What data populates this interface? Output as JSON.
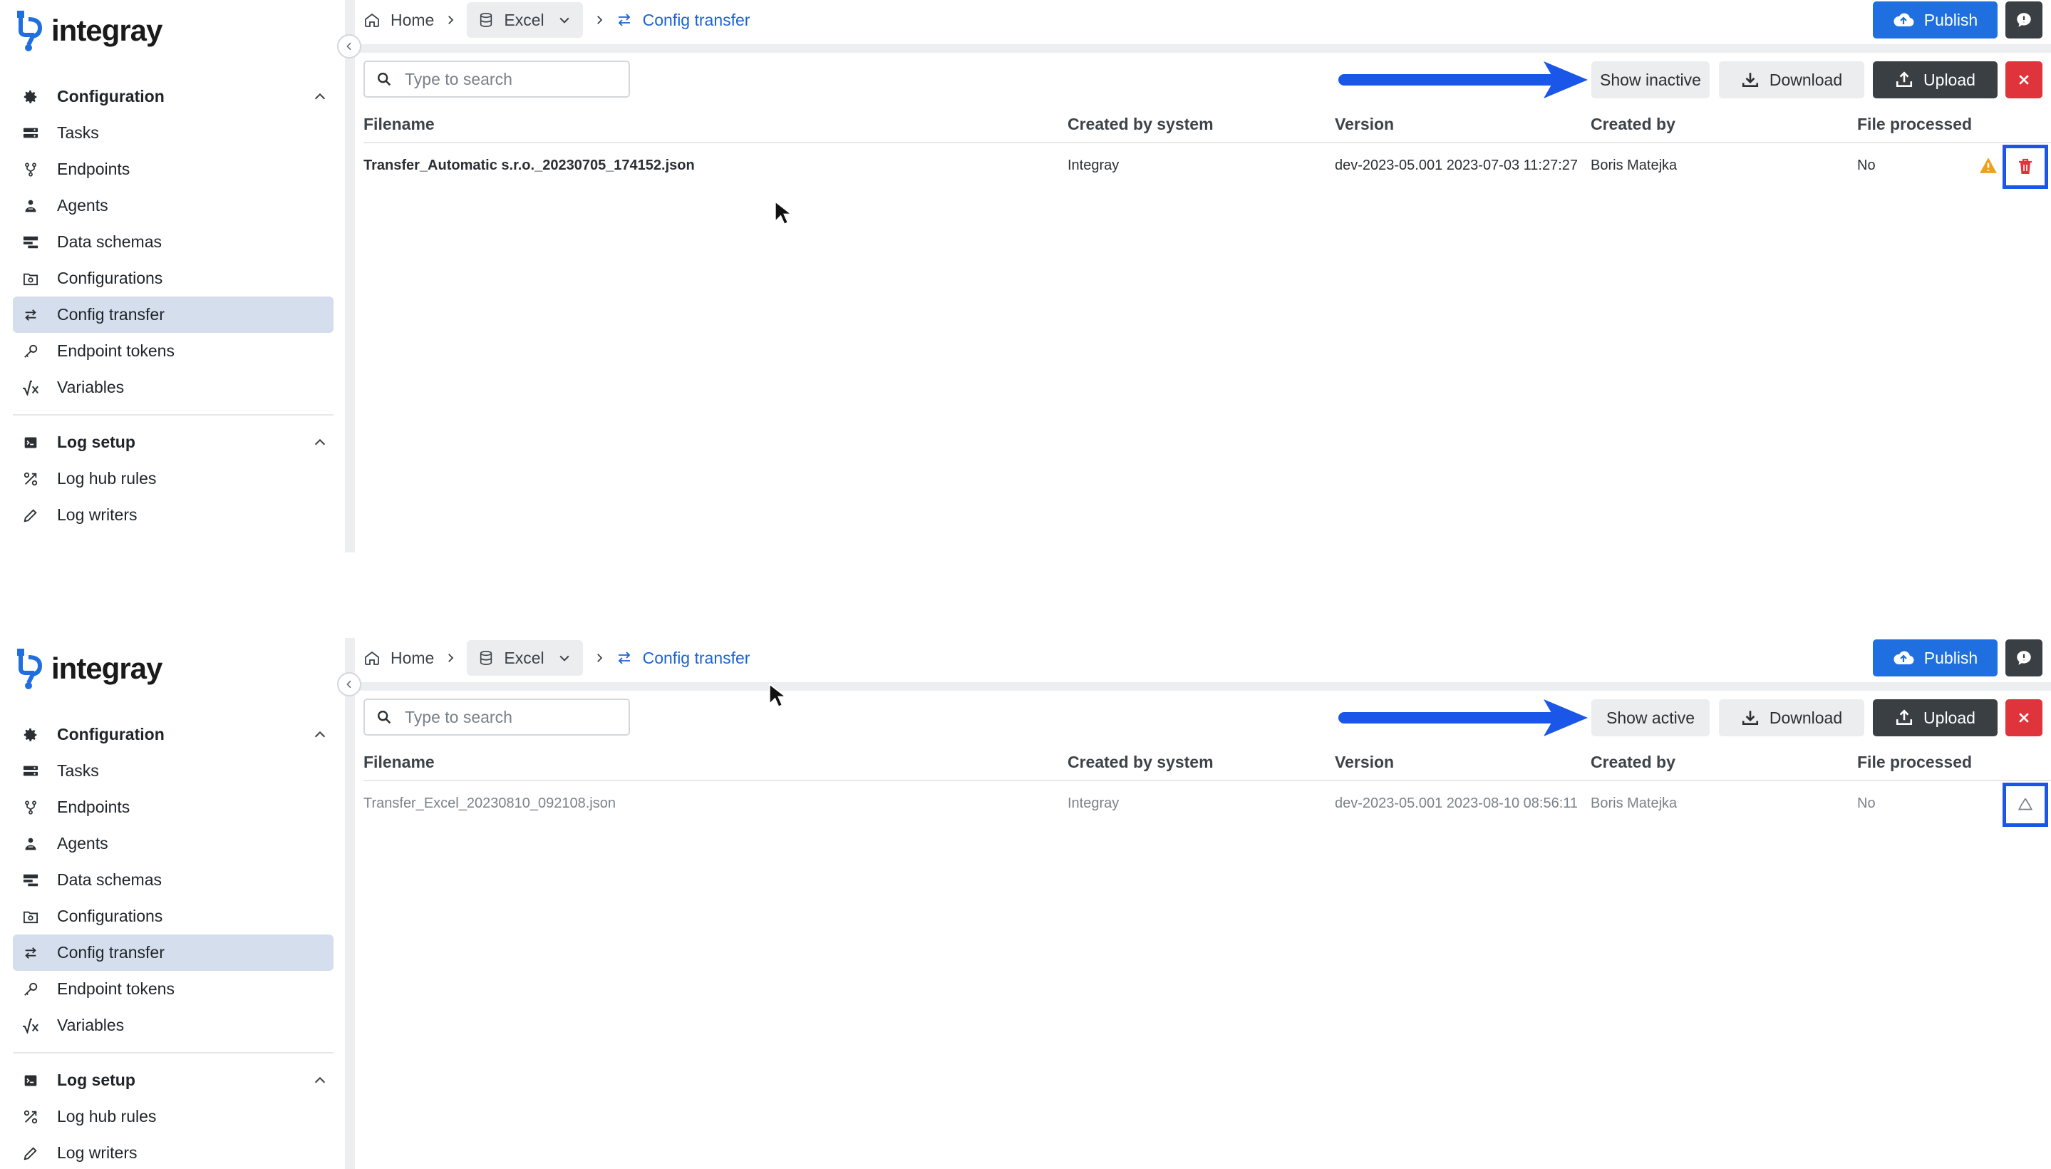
{
  "app": {
    "logo_text": "integray",
    "colors": {
      "accent": "#1f6fe0",
      "active_nav": "#d5deec",
      "danger": "#e0343d",
      "dark": "#3a3f44",
      "highlight": "#1a56e8",
      "warning": "#f0a020"
    }
  },
  "panels": [
    {
      "sidebar": {
        "config_group": "Configuration",
        "items": [
          {
            "label": "Tasks",
            "icon": "tasks-icon"
          },
          {
            "label": "Endpoints",
            "icon": "endpoints-icon"
          },
          {
            "label": "Agents",
            "icon": "agents-icon"
          },
          {
            "label": "Data schemas",
            "icon": "data-schemas-icon"
          },
          {
            "label": "Configurations",
            "icon": "configurations-icon"
          },
          {
            "label": "Config transfer",
            "icon": "transfer-icon",
            "active": true
          },
          {
            "label": "Endpoint tokens",
            "icon": "key-icon"
          },
          {
            "label": "Variables",
            "icon": "variables-icon"
          }
        ],
        "log_group": "Log setup",
        "log_items": [
          {
            "label": "Log hub rules",
            "icon": "log-hub-rules-icon"
          },
          {
            "label": "Log writers",
            "icon": "pen-icon"
          }
        ]
      },
      "breadcrumb": {
        "home": "Home",
        "project": "Excel",
        "current": "Config transfer"
      },
      "toolbar": {
        "publish": "Publish",
        "toggle": "Show inactive",
        "download": "Download",
        "upload": "Upload"
      },
      "search": {
        "placeholder": "Type to search"
      },
      "table": {
        "headers": [
          "Filename",
          "Created by system",
          "Version",
          "Created by",
          "File processed"
        ],
        "row": {
          "filename": "Transfer_Automatic s.r.o._20230705_174152.json",
          "system": "Integray",
          "version": "dev-2023-05.001 2023-07-03 11:27:27",
          "created_by": "Boris Matejka",
          "processed": "No",
          "action": "trash-icon",
          "warning": true
        }
      }
    },
    {
      "sidebar": {
        "config_group": "Configuration",
        "items": [
          {
            "label": "Tasks",
            "icon": "tasks-icon"
          },
          {
            "label": "Endpoints",
            "icon": "endpoints-icon"
          },
          {
            "label": "Agents",
            "icon": "agents-icon"
          },
          {
            "label": "Data schemas",
            "icon": "data-schemas-icon"
          },
          {
            "label": "Configurations",
            "icon": "configurations-icon"
          },
          {
            "label": "Config transfer",
            "icon": "transfer-icon",
            "active": true
          },
          {
            "label": "Endpoint tokens",
            "icon": "key-icon"
          },
          {
            "label": "Variables",
            "icon": "variables-icon"
          }
        ],
        "log_group": "Log setup",
        "log_items": [
          {
            "label": "Log hub rules",
            "icon": "log-hub-rules-icon"
          },
          {
            "label": "Log writers",
            "icon": "pen-icon"
          }
        ]
      },
      "breadcrumb": {
        "home": "Home",
        "project": "Excel",
        "current": "Config transfer"
      },
      "toolbar": {
        "publish": "Publish",
        "toggle": "Show active",
        "download": "Download",
        "upload": "Upload"
      },
      "search": {
        "placeholder": "Type to search"
      },
      "table": {
        "headers": [
          "Filename",
          "Created by system",
          "Version",
          "Created by",
          "File processed"
        ],
        "row": {
          "filename": "Transfer_Excel_20230810_092108.json",
          "system": "Integray",
          "version": "dev-2023-05.001 2023-08-10 08:56:11",
          "created_by": "Boris Matejka",
          "processed": "No",
          "action": "restore-icon",
          "warning": false
        }
      }
    }
  ]
}
